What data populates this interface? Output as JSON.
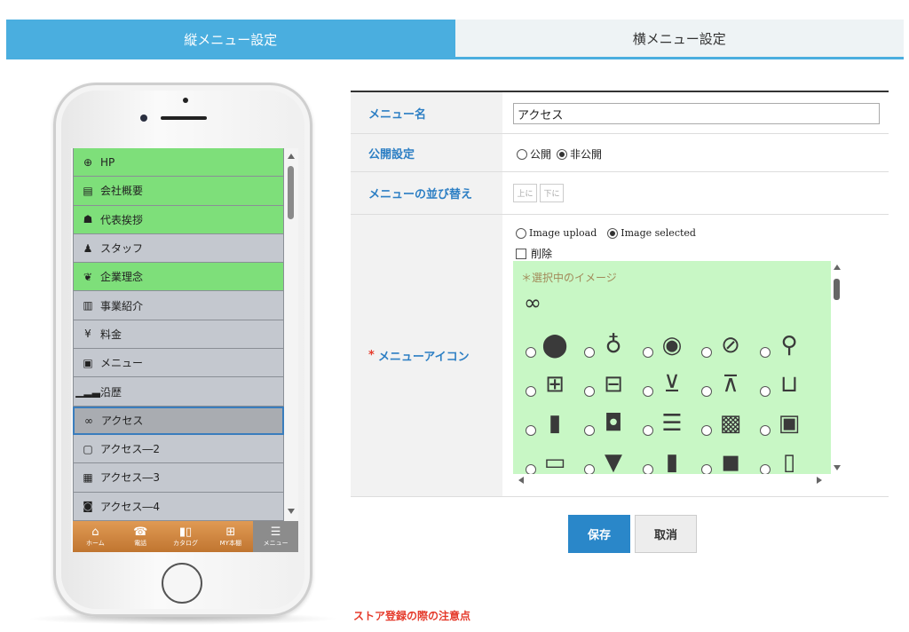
{
  "tabs": [
    {
      "label": "縦メニュー設定",
      "active": true
    },
    {
      "label": "横メニュー設定",
      "active": false
    }
  ],
  "phone": {
    "menu_items": [
      {
        "label": "HP",
        "icon": "globe-icon",
        "glyph": "⊕",
        "style": "green"
      },
      {
        "label": "会社概要",
        "icon": "document-icon",
        "glyph": "▤",
        "style": "green"
      },
      {
        "label": "代表挨拶",
        "icon": "person-icon",
        "glyph": "☗",
        "style": "green"
      },
      {
        "label": "スタッフ",
        "icon": "staff-icon",
        "glyph": "♟",
        "style": "gray"
      },
      {
        "label": "企業理念",
        "icon": "laurel-icon",
        "glyph": "❦",
        "style": "green"
      },
      {
        "label": "事業紹介",
        "icon": "notebook-icon",
        "glyph": "▥",
        "style": "gray"
      },
      {
        "label": "料金",
        "icon": "yen-coin-icon",
        "glyph": "¥",
        "style": "gray"
      },
      {
        "label": "メニュー",
        "icon": "image-frame-icon",
        "glyph": "▣",
        "style": "gray"
      },
      {
        "label": "沿歴",
        "icon": "signal-bars-icon",
        "glyph": "▁▂▃",
        "style": "gray"
      },
      {
        "label": "アクセス",
        "icon": "link-icon",
        "glyph": "∞",
        "style": "selected"
      },
      {
        "label": "アクセス―2",
        "icon": "map-pin-card-icon",
        "glyph": "▢",
        "style": "gray"
      },
      {
        "label": "アクセス―3",
        "icon": "map-icon",
        "glyph": "▦",
        "style": "gray"
      },
      {
        "label": "アクセス―4",
        "icon": "location-box-icon",
        "glyph": "◙",
        "style": "gray"
      }
    ],
    "bottom_nav": [
      {
        "label": "ホーム",
        "icon": "home-icon",
        "glyph": "⌂"
      },
      {
        "label": "電話",
        "icon": "phone-icon",
        "glyph": "☎"
      },
      {
        "label": "カタログ",
        "icon": "catalog-icon",
        "glyph": "▮▯"
      },
      {
        "label": "MY本棚",
        "icon": "book-icon",
        "glyph": "⊞"
      },
      {
        "label": "メニュー",
        "icon": "list-menu-icon",
        "glyph": "☰",
        "active": true
      }
    ]
  },
  "form": {
    "menu_name_label": "メニュー名",
    "menu_name_value": "アクセス",
    "publish_label": "公開設定",
    "publish_options": [
      "公開",
      "非公開"
    ],
    "publish_selected": "非公開",
    "order_label": "メニューの並び替え",
    "order_up": "上に",
    "order_down": "下に",
    "icon_label": "メニューアイコン",
    "required_mark": "*",
    "image_upload_label": "Image upload",
    "image_selected_label": "Image selected",
    "delete_label": "削除",
    "panel_title": "＊選択中のイメージ",
    "icon_rows": [
      [
        {
          "name": "map-pin-filled-icon",
          "glyph": "⬤"
        },
        {
          "name": "person-pin-icon",
          "glyph": "♁"
        },
        {
          "name": "location-outline-icon",
          "glyph": "◉"
        },
        {
          "name": "compass-icon",
          "glyph": "⊘"
        },
        {
          "name": "map-pin-outline-icon",
          "glyph": "⚲"
        }
      ],
      [
        {
          "name": "shopping-basket-icon",
          "glyph": "⊞"
        },
        {
          "name": "basket-star-icon",
          "glyph": "⊟"
        },
        {
          "name": "cart-icon",
          "glyph": "⊻"
        },
        {
          "name": "cart-outline-icon",
          "glyph": "⊼"
        },
        {
          "name": "basket-outline-icon",
          "glyph": "⊔"
        }
      ],
      [
        {
          "name": "book-icon",
          "glyph": "▮"
        },
        {
          "name": "book-star-icon",
          "glyph": "◘"
        },
        {
          "name": "books-stack-icon",
          "glyph": "☰"
        },
        {
          "name": "notebook-star-icon",
          "glyph": "▩"
        },
        {
          "name": "contact-book-icon",
          "glyph": "▣"
        }
      ],
      [
        {
          "name": "folder-icon",
          "glyph": "▭"
        },
        {
          "name": "filter-icon",
          "glyph": "▼"
        },
        {
          "name": "door-icon",
          "glyph": "▮"
        },
        {
          "name": "folder-camera-icon",
          "glyph": "◼"
        },
        {
          "name": "folder-outline-icon",
          "glyph": "▯"
        }
      ]
    ],
    "save_label": "保存",
    "cancel_label": "取消"
  },
  "footer": {
    "store_note": "ストア登録の際の注意点"
  }
}
